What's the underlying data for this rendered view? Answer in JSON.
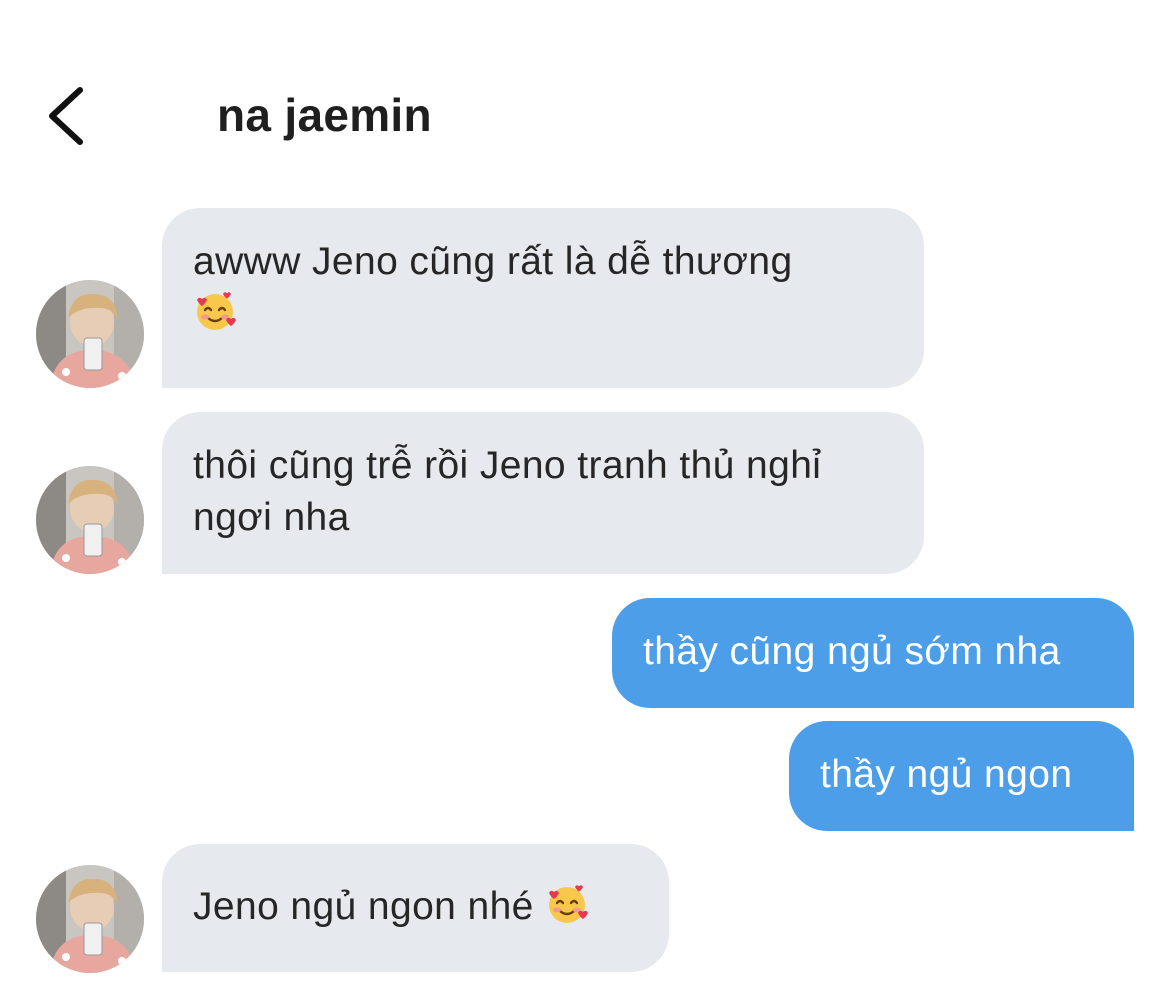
{
  "header": {
    "title": "na jaemin",
    "back_icon": "chevron-left-icon"
  },
  "messages": [
    {
      "sender": "contact",
      "text": "awww Jeno cũng rất là dễ thương",
      "emoji": "smiling-face-with-hearts-icon"
    },
    {
      "sender": "contact",
      "text": "thôi cũng trễ rồi Jeno tranh thủ nghỉ ngơi nha"
    },
    {
      "sender": "me",
      "text": "thầy cũng ngủ sớm nha"
    },
    {
      "sender": "me",
      "text": "thầy ngủ ngon"
    },
    {
      "sender": "contact",
      "text": "Jeno ngủ ngon nhé",
      "emoji": "smiling-face-with-hearts-icon"
    }
  ],
  "colors": {
    "incoming_bubble": "#e6eaef",
    "outgoing_bubble": "#4d9ee9",
    "text": "#262626"
  }
}
